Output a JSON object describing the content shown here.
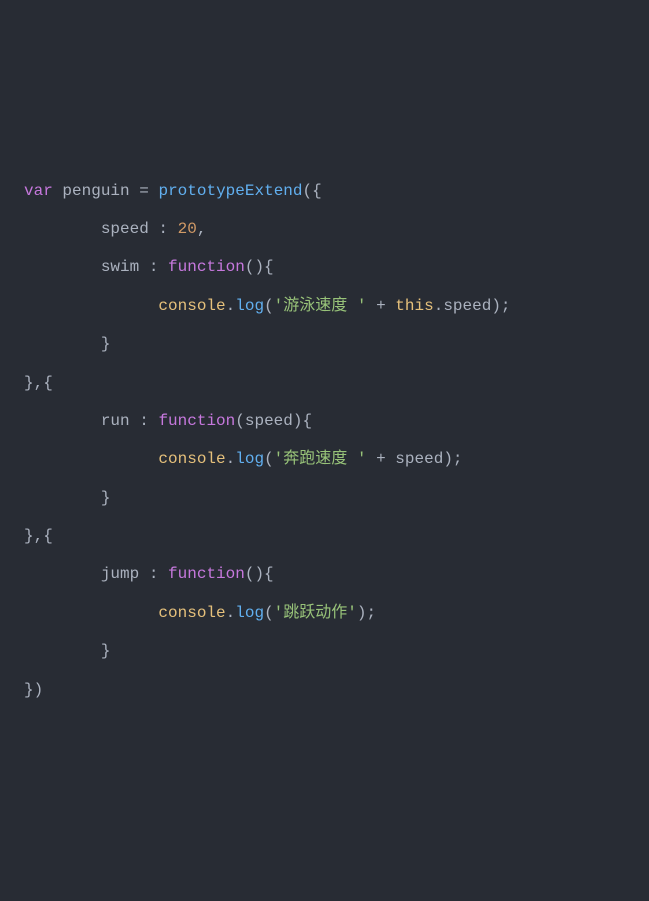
{
  "code": {
    "line1": {
      "var": "var",
      "varname": "penguin",
      "equals": "=",
      "func": "prototypeExtend",
      "open": "({"
    },
    "line2": {
      "indent": "        ",
      "prop": "speed",
      "colon": " : ",
      "value": "20",
      "comma": ","
    },
    "line3": {
      "indent": "        ",
      "prop": "swim",
      "colon": " : ",
      "func_kw": "function",
      "parens": "(){"
    },
    "line4": {
      "indent": "              ",
      "console": "console",
      "dot": ".",
      "log": "log",
      "open": "(",
      "str": "'游泳速度 '",
      "plus": " + ",
      "this": "this",
      "dot2": ".",
      "prop": "speed",
      "close": ");"
    },
    "line5": {
      "indent": "        ",
      "close": "}"
    },
    "line6": {
      "text": "},{"
    },
    "line7": {
      "indent": "        ",
      "prop": "run",
      "colon": " : ",
      "func_kw": "function",
      "open": "(",
      "param": "speed",
      "close": "){"
    },
    "line8": {
      "indent": "              ",
      "console": "console",
      "dot": ".",
      "log": "log",
      "open": "(",
      "str": "'奔跑速度 '",
      "plus": " + ",
      "param": "speed",
      "close": ");"
    },
    "line9": {
      "indent": "        ",
      "close": "}"
    },
    "line10": {
      "text": "},{"
    },
    "line11": {
      "indent": "        ",
      "prop": "jump",
      "colon": " : ",
      "func_kw": "function",
      "parens": "(){"
    },
    "line12": {
      "indent": "              ",
      "console": "console",
      "dot": ".",
      "log": "log",
      "open": "(",
      "str": "'跳跃动作'",
      "close": ");"
    },
    "line13": {
      "indent": "        ",
      "close": "}"
    },
    "line14": {
      "text": "})"
    }
  }
}
